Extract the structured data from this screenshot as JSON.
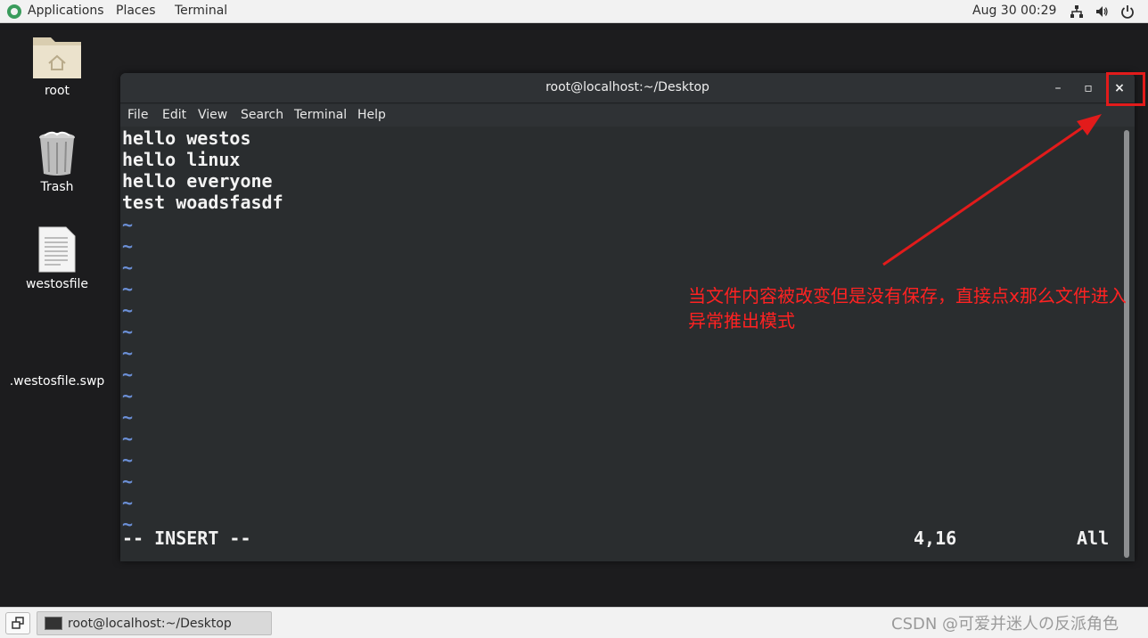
{
  "topbar": {
    "applications": "Applications",
    "places": "Places",
    "terminal": "Terminal",
    "clock": "Aug 30  00:29"
  },
  "desktop": {
    "items": [
      {
        "label": "root",
        "icon": "home-folder-icon"
      },
      {
        "label": "Trash",
        "icon": "trash-icon"
      },
      {
        "label": "westosfile",
        "icon": "text-file-icon"
      },
      {
        "label": ".westosfile.swp",
        "icon": "swap-file-icon"
      }
    ]
  },
  "window": {
    "title": "root@localhost:~/Desktop",
    "minimize": "–",
    "maximize": "▫",
    "close": "×",
    "menu": [
      "File",
      "Edit",
      "View",
      "Search",
      "Terminal",
      "Help"
    ]
  },
  "editor": {
    "lines": [
      "hello westos",
      "hello linux",
      "hello everyone",
      "test woadsfasdf"
    ],
    "tilde": "~",
    "mode": "-- INSERT --",
    "position": "4,16",
    "scroll": "All"
  },
  "annotation": {
    "text": "当文件内容被改变但是没有保存，直接点x那么文件进入异常推出模式",
    "color": "#ff2222"
  },
  "taskbar": {
    "window_label": "root@localhost:~/Desktop"
  },
  "watermark": "CSDN @可爱并迷人の反派角色"
}
